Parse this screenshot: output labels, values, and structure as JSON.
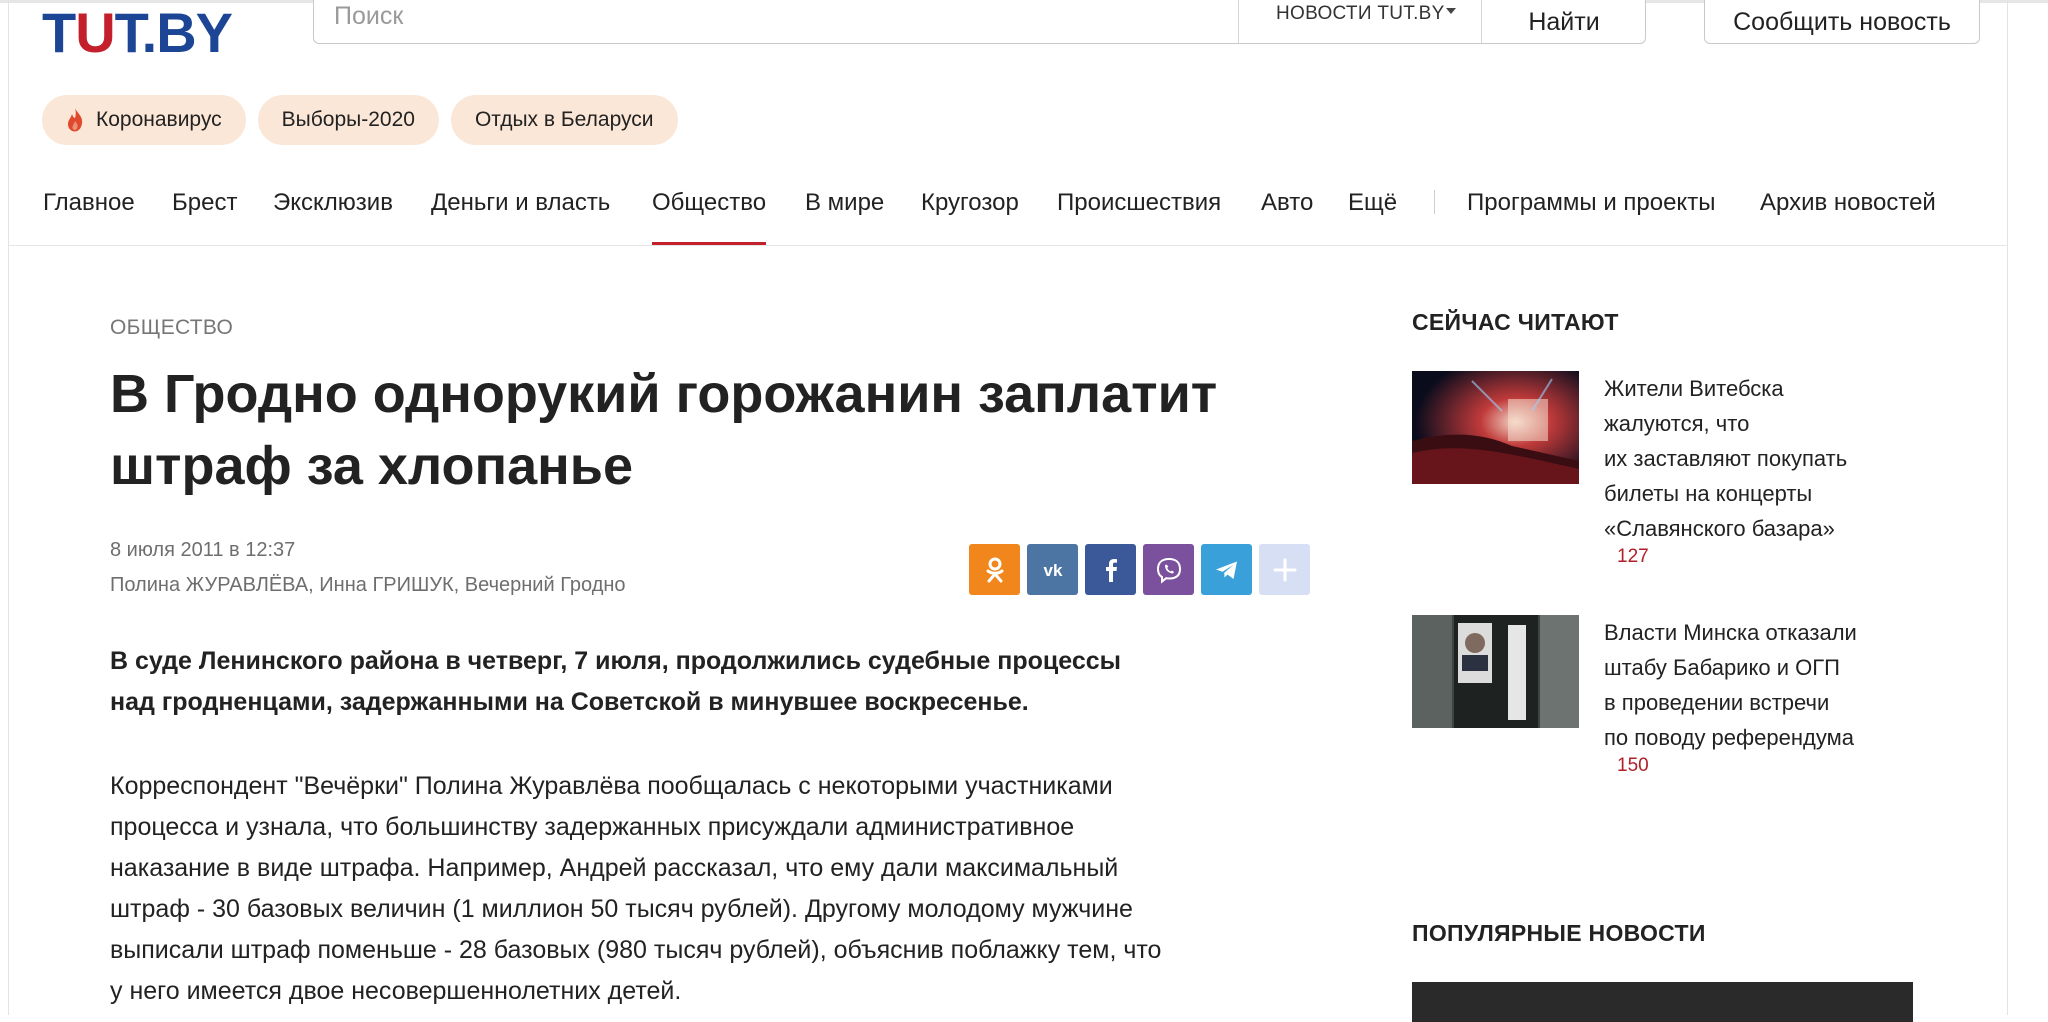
{
  "header": {
    "logo": {
      "part1": "T",
      "part2": "U",
      "part3": "T.BY"
    },
    "search": {
      "placeholder": "Поиск",
      "scope": "НОВОСТИ TUT.BY",
      "submit_label": "Найти"
    },
    "report_label": "Сообщить новость"
  },
  "tags": [
    {
      "label": "Коронавирус",
      "icon": "fire-icon"
    },
    {
      "label": "Выборы-2020"
    },
    {
      "label": "Отдых в Беларуси"
    }
  ],
  "nav": {
    "items": [
      {
        "label": "Главное"
      },
      {
        "label": "Брест"
      },
      {
        "label": "Эксклюзив"
      },
      {
        "label": "Деньги и власть"
      },
      {
        "label": "Общество",
        "active": true
      },
      {
        "label": "В мире"
      },
      {
        "label": "Кругозор"
      },
      {
        "label": "Происшествия"
      },
      {
        "label": "Авто"
      },
      {
        "label": "Ещё"
      }
    ],
    "extra": [
      {
        "label": "Программы и проекты"
      },
      {
        "label": "Архив новостей"
      }
    ],
    "active_color": "#c3202c"
  },
  "article": {
    "rubric": "ОБЩЕСТВО",
    "headline_line1": "В Гродно однорукий горожанин заплатит",
    "headline_line2": "штраф за хлопанье",
    "date": "8 июля 2011 в 12:37",
    "authors": "Полина ЖУРАВЛЁВА, Инна ГРИШУК, Вечерний Гродно",
    "lead_line1": "В суде Ленинского района в четверг, 7 июля, продолжились судебные процессы",
    "lead_line2": "над гродненцами, задержанными на Советской в минувшее воскресенье.",
    "body_lines": [
      "Корреспондент \"Вечёрки\" Полина Журавлёва пообщалась с некоторыми участниками",
      "процесса и узнала, что большинству задержанных присуждали административное",
      "наказание в виде штрафа. Например, Андрей рассказал, что ему дали максимальный",
      "штраф - 30 базовых величин (1 миллион 50 тысяч рублей). Другому молодому мужчине",
      "выписали штраф поменьше - 28 базовых (980 тысяч рублей), объяснив поблажку тем, что",
      "у него имеется двое несовершеннолетних детей."
    ]
  },
  "share": [
    {
      "icon": "odnoklassniki-icon",
      "color": "#f0861c"
    },
    {
      "icon": "vk-icon",
      "color": "#4c75a3"
    },
    {
      "icon": "facebook-icon",
      "color": "#3b5998"
    },
    {
      "icon": "viber-icon",
      "color": "#7b519d"
    },
    {
      "icon": "telegram-icon",
      "color": "#3aa0da"
    },
    {
      "icon": "plus-icon",
      "color": "#d6dff3"
    }
  ],
  "sidebar": {
    "now_reading_title": "СЕЙЧАС ЧИТАЮТ",
    "now_reading": [
      {
        "lines": [
          "Жители Витебска",
          "жалуются, что",
          "их заставляют покупать",
          "билеты на концерты",
          "«Славянского базара»"
        ],
        "count": "127"
      },
      {
        "lines": [
          "Власти Минска отказали",
          "штабу Бабарико и ОГП",
          "в проведении встречи",
          "по поводу референдума"
        ],
        "count": "150"
      }
    ],
    "popular_title": "ПОПУЛЯРНЫЕ НОВОСТИ"
  }
}
